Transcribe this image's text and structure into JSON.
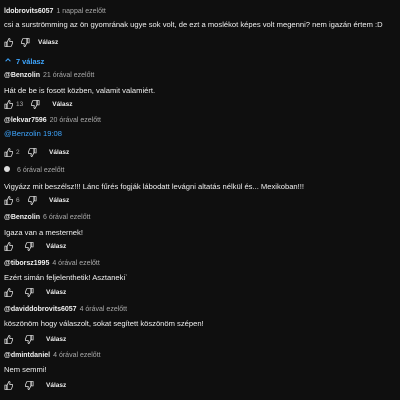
{
  "top": {
    "author": "ldobrovits6057",
    "time": "1 nappal ezelőtt",
    "text": "csi a surströmming az ön gyomrának ugye sok volt, de ezt a moslékot képes volt megenni? nem igazán értem :D",
    "reply_label": "Válasz"
  },
  "replies_toggle": {
    "label": "7 válasz"
  },
  "comments": [
    {
      "author": "@Benzolin",
      "time": "21 órával ezelőtt",
      "text": "Hát de be is fosott közben, valamit valamiért.",
      "likes": "13",
      "reply_label": "Válasz"
    },
    {
      "author": "@lekvar7596",
      "time": "20 órával ezelőtt",
      "mention": "@Benzolin",
      "text": "19:08",
      "likes": "2",
      "reply_label": "Válasz"
    },
    {
      "author": "",
      "time": "6 órával ezelőtt",
      "text": "Vigyázz mit beszélsz!!! Lánc fűrés fogják lábodatt levágni altatás nélkül és... Mexikoban!!!",
      "likes": "6",
      "reply_label": "Válasz"
    },
    {
      "author": "@Benzolin",
      "time": "6 órával ezelőtt",
      "text": "Igaza van a mesternek!",
      "likes": "",
      "reply_label": "Válasz"
    },
    {
      "author": "@tiborsz1995",
      "time": "4 órával ezelőtt",
      "text": "Ezért simán feljelenthetik! Asztaneki`",
      "likes": "",
      "reply_label": "Válasz"
    },
    {
      "author": "@daviddobrovits6057",
      "time": "4 órával ezelőtt",
      "text": "köszönöm hogy válaszolt, sokat segített köszönöm szépen!",
      "likes": "",
      "reply_label": "Válasz"
    },
    {
      "author": "@dmintdaniel",
      "time": "4 órával ezelőtt",
      "text": "Nem semmi!",
      "likes": "",
      "reply_label": "Válasz"
    }
  ]
}
